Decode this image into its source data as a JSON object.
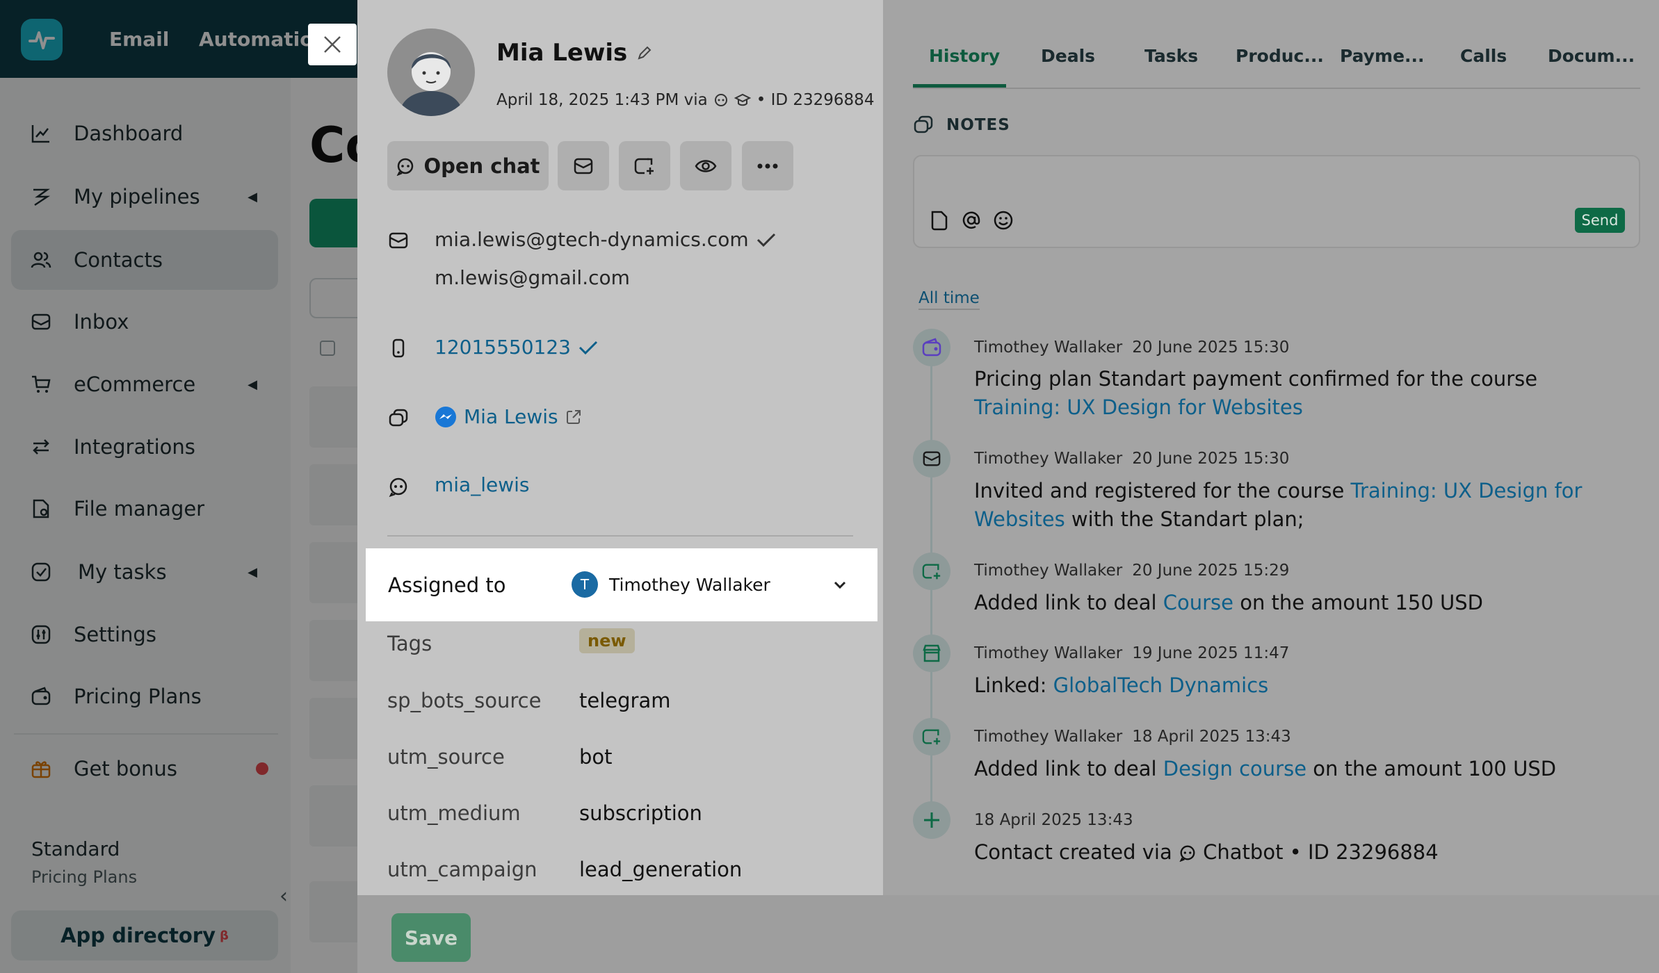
{
  "topbar": {
    "nav": [
      "Email",
      "Automation"
    ]
  },
  "sidebar": {
    "items": [
      {
        "label": "Dashboard",
        "icon": "chart-line-icon"
      },
      {
        "label": "My pipelines",
        "icon": "pipeline-icon"
      },
      {
        "label": "Contacts",
        "icon": "users-icon"
      },
      {
        "label": "Inbox",
        "icon": "inbox-icon"
      },
      {
        "label": "eCommerce",
        "icon": "cart-icon"
      },
      {
        "label": "Integrations",
        "icon": "arrows-icon"
      },
      {
        "label": "File manager",
        "icon": "file-icon"
      },
      {
        "label": "My tasks",
        "icon": "check-icon"
      },
      {
        "label": "Settings",
        "icon": "settings-icon"
      },
      {
        "label": "Pricing Plans",
        "icon": "wallet-icon"
      }
    ],
    "bonus_label": "Get bonus",
    "plan_name": "Standard",
    "plan_sub": "Pricing Plans",
    "app_directory": "App directory",
    "app_directory_badge": "β"
  },
  "page": {
    "title": "Co"
  },
  "contact": {
    "name": "Mia Lewis",
    "created_prefix": "April 18, 2025 1:43 PM via",
    "id_text": "• ID 23296884",
    "open_chat": "Open chat",
    "email_primary": "mia.lewis@gtech-dynamics.com",
    "email_secondary": "m.lewis@gmail.com",
    "phone": "12015550123",
    "messenger": "Mia Lewis",
    "username": "mia_lewis",
    "assigned_label": "Assigned to",
    "assignee_initial": "T",
    "assignee": "Timothey Wallaker",
    "tags_label": "Tags",
    "tag": "new",
    "fields": [
      {
        "label": "sp_bots_source",
        "value": "telegram"
      },
      {
        "label": "utm_source",
        "value": "bot"
      },
      {
        "label": "utm_medium",
        "value": "subscription"
      },
      {
        "label": "utm_campaign",
        "value": "lead_generation"
      }
    ],
    "save": "Save"
  },
  "history": {
    "tabs": [
      "History",
      "Deals",
      "Tasks",
      "Produc...",
      "Payme...",
      "Calls",
      "Docum..."
    ],
    "notes_label": "NOTES",
    "send": "Send",
    "all_time": "All time",
    "events": [
      {
        "author": "Timothey Wallaker",
        "time": "20 June 2025 15:30",
        "pre": "Pricing plan Standart payment confirmed for the course ",
        "link": "Training: UX Design for Websites",
        "post": ""
      },
      {
        "author": "Timothey Wallaker",
        "time": "20 June 2025 15:30",
        "pre": "Invited and registered for the course ",
        "link": "Training: UX Design for Websites",
        "post": " with the Standart plan;"
      },
      {
        "author": "Timothey Wallaker",
        "time": "20 June 2025 15:29",
        "pre": "Added link to deal ",
        "link": "Course",
        "post": " on the amount 150 USD"
      },
      {
        "author": "Timothey Wallaker",
        "time": "19 June 2025 11:47",
        "pre": "Linked: ",
        "link": "GlobalTech Dynamics",
        "post": ""
      },
      {
        "author": "Timothey Wallaker",
        "time": "18 April 2025 13:43",
        "pre": "Added link to deal ",
        "link": "Design course",
        "post": " on the amount 100 USD"
      },
      {
        "author": "",
        "time": "18 April 2025 13:43",
        "pre": "Contact created via ",
        "link": "",
        "post": " Chatbot • ID 23296884"
      }
    ]
  }
}
